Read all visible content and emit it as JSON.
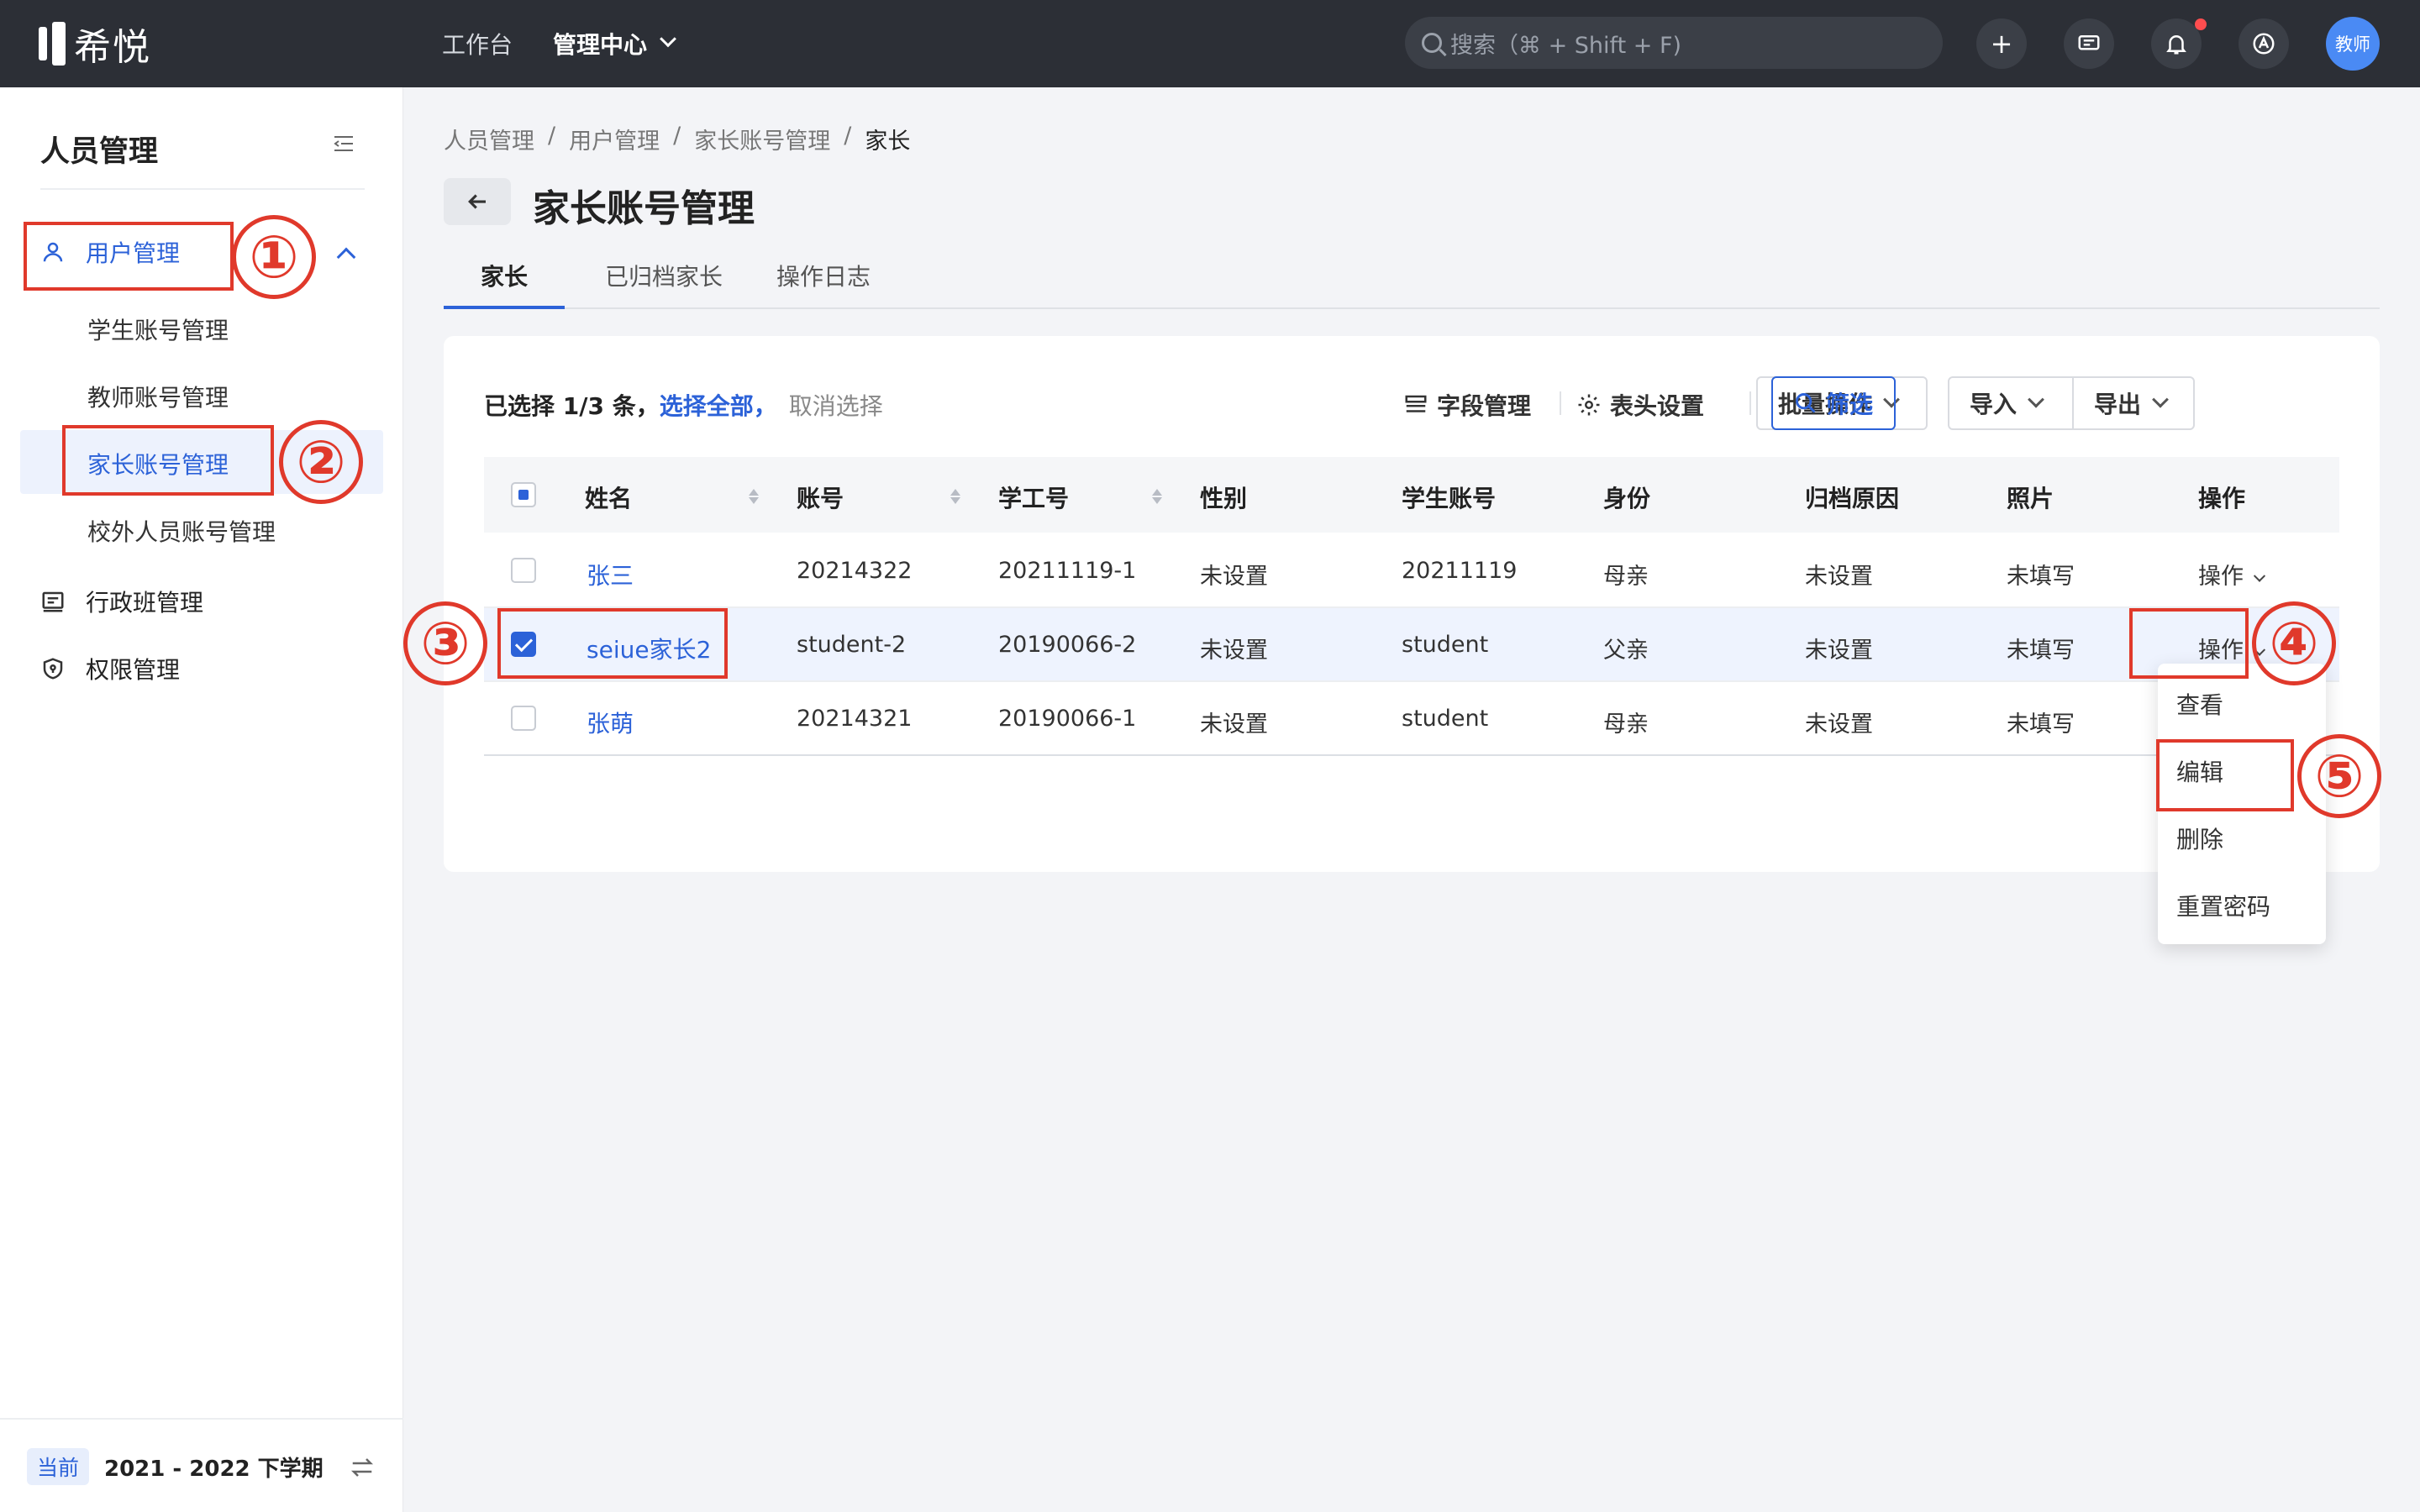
{
  "topbar": {
    "logo_text": "希悦",
    "nav_workbench": "工作台",
    "nav_admin": "管理中心",
    "search_placeholder": "搜索（⌘ + Shift + F)",
    "add_icon": "+",
    "avatar_label": "教师",
    "icons": [
      "plus-icon",
      "message-icon",
      "bell-icon",
      "help-icon"
    ],
    "notification_dot_color": "#ff4d4f"
  },
  "sidebar": {
    "title": "人员管理",
    "user_mgmt": "用户管理",
    "sub_items": [
      "学生账号管理",
      "教师账号管理",
      "家长账号管理",
      "校外人员账号管理"
    ],
    "class_mgmt": "行政班管理",
    "perm_mgmt": "权限管理",
    "term_tag": "当前",
    "term": "2021 - 2022 下学期"
  },
  "breadcrumb": [
    "人员管理",
    "/",
    "用户管理",
    "/",
    "家长账号管理",
    "/",
    "家长"
  ],
  "page": {
    "title": "家长账号管理",
    "tabs": [
      "家长",
      "已归档家长",
      "操作日志"
    ]
  },
  "toolbar": {
    "sel_prefix": "已选择 1/3 条，",
    "select_all": "选择全部",
    "comma": "，",
    "cancel_select": "取消选择",
    "field_mgmt": "字段管理",
    "header_settings": "表头设置",
    "batch": "批量操作",
    "import": "导入",
    "export": "导出",
    "filter": "筛选"
  },
  "table": {
    "columns": [
      "姓名",
      "账号",
      "学工号",
      "性别",
      "学生账号",
      "身份",
      "归档原因",
      "照片",
      "操作"
    ],
    "rows": [
      {
        "name": "张三",
        "account": "20214322",
        "staff_no": "20211119-1",
        "gender": "未设置",
        "student_account": "20211119",
        "identity": "母亲",
        "archive_reason": "未设置",
        "photo": "未填写",
        "action": "操作",
        "checked": false
      },
      {
        "name": "seiue家长2",
        "account": "student-2",
        "staff_no": "20190066-2",
        "gender": "未设置",
        "student_account": "student",
        "identity": "父亲",
        "archive_reason": "未设置",
        "photo": "未填写",
        "action": "操作",
        "checked": true
      },
      {
        "name": "张萌",
        "account": "20214321",
        "staff_no": "20190066-1",
        "gender": "未设置",
        "student_account": "student",
        "identity": "母亲",
        "archive_reason": "未设置",
        "photo": "未填写",
        "action": "",
        "checked": false
      }
    ]
  },
  "action_menu": [
    "查看",
    "编辑",
    "删除",
    "重置密码"
  ],
  "annotations": [
    "①",
    "②",
    "③",
    "④",
    "⑤"
  ],
  "colors": {
    "accent": "#2c62d8",
    "annotation": "#e0392b",
    "topbar": "#2c2f36"
  }
}
